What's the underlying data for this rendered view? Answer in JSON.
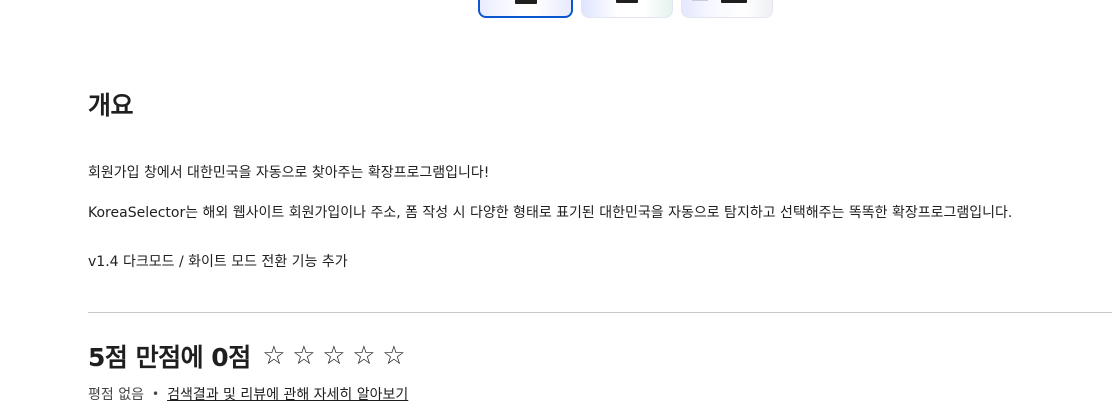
{
  "thumbnails": [
    {
      "selected": true
    },
    {
      "selected": false
    },
    {
      "selected": false
    }
  ],
  "overview": {
    "heading": "개요",
    "line1": "회원가입 창에서 대한민국을 자동으로 찾아주는 확장프로그램입니다!",
    "line2": "KoreaSelector는 해외 웹사이트 회원가입이나 주소,  폼 작성 시 다양한 형태로 표기된 대한민국을 자동으로 탐지하고 선택해주는 똑똑한 확장프로그램입니다.",
    "line3": "v1.4 다크모드 / 화이트 모드 전환 기능 추가"
  },
  "rating": {
    "title": "5점 만점에 0점",
    "stars": [
      "☆",
      "☆",
      "☆",
      "☆",
      "☆"
    ],
    "no_rating": "평점 없음",
    "separator": "•",
    "learn_more": "검색결과 및 리뷰에 관해 자세히 알아보기"
  },
  "colors": {
    "accent": "#0b57d0",
    "text": "#1f1f1f",
    "divider": "#c7c7c7"
  }
}
